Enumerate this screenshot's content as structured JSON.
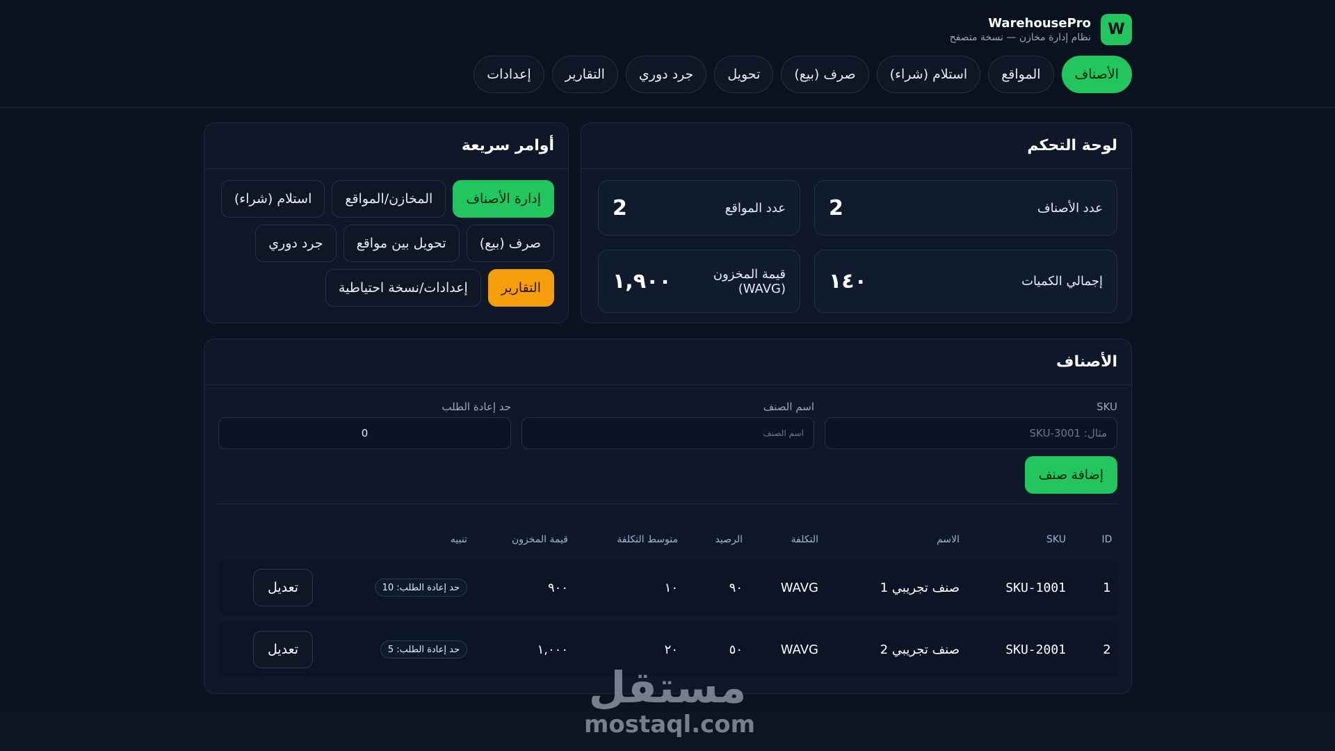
{
  "brand": {
    "logo_letter": "W",
    "title": "WarehousePro",
    "subtitle": "نظام إدارة مخازن — نسخة متصفح"
  },
  "nav": [
    {
      "label": "الأصناف",
      "active": true
    },
    {
      "label": "المواقع",
      "active": false
    },
    {
      "label": "استلام (شراء)",
      "active": false
    },
    {
      "label": "صرف (بيع)",
      "active": false
    },
    {
      "label": "تحويل",
      "active": false
    },
    {
      "label": "جرد دوري",
      "active": false
    },
    {
      "label": "التقارير",
      "active": false
    },
    {
      "label": "إعدادات",
      "active": false
    }
  ],
  "dashboard": {
    "title": "لوحة التحكم",
    "stats": {
      "items_count": {
        "label": "عدد الأصناف",
        "value": "2"
      },
      "locations_count": {
        "label": "عدد المواقع",
        "value": "2"
      },
      "total_qty": {
        "label": "إجمالي الكميات",
        "value": "١٤٠"
      },
      "stock_value": {
        "label": "قيمة المخزون (WAVG)",
        "value": "١,٩٠٠"
      }
    }
  },
  "quick": {
    "title": "أوامر سريعة",
    "buttons": {
      "items": "إدارة الأصناف",
      "warehouses": "المخازن/المواقع",
      "receive": "استلام (شراء)",
      "issue": "صرف (بيع)",
      "transfer": "تحويل بين مواقع",
      "count": "جرد دوري",
      "reports": "التقارير",
      "settings": "إعدادات/نسخة احتياطية"
    }
  },
  "items": {
    "title": "الأصناف",
    "form": {
      "sku_label": "SKU",
      "sku_placeholder": "مثال: SKU-3001",
      "name_label": "اسم الصنف",
      "name_placeholder": "اسم الصنف",
      "reorder_label": "حد إعادة الطلب",
      "reorder_value": "0",
      "add_button": "إضافة صنف"
    },
    "columns": {
      "id": "ID",
      "sku": "SKU",
      "name": "الاسم",
      "cost": "التكلفة",
      "balance": "الرصيد",
      "avg_cost": "متوسط التكلفة",
      "stock_value": "قيمة المخزون",
      "alert": "تنبيه"
    },
    "rows": [
      {
        "id": "1",
        "sku": "SKU-1001",
        "name": "صنف تجريبي 1",
        "cost": "WAVG",
        "balance": "٩٠",
        "avg_cost": "١٠",
        "stock_value": "٩٠٠",
        "alert": "حد إعادة الطلب: 10",
        "edit": "تعديل"
      },
      {
        "id": "2",
        "sku": "SKU-2001",
        "name": "صنف تجريبي 2",
        "cost": "WAVG",
        "balance": "٥٠",
        "avg_cost": "٢٠",
        "stock_value": "١,٠٠٠",
        "alert": "حد إعادة الطلب: 5",
        "edit": "تعديل"
      }
    ]
  },
  "watermark": {
    "arabic": "مستقل",
    "latin": "mostaql.com"
  },
  "colors": {
    "background": "#0b1220",
    "accent_green": "#22c55e",
    "accent_orange": "#f59e0b",
    "card": "#0f1829"
  }
}
